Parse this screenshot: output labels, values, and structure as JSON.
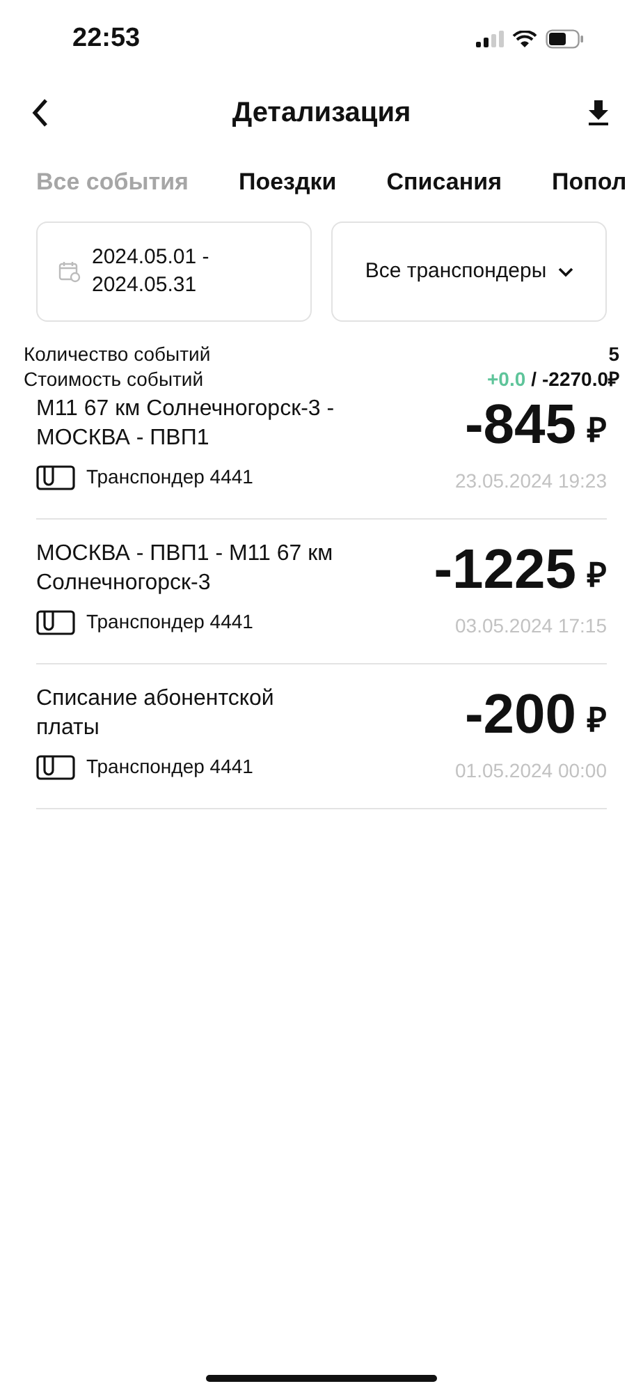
{
  "status_bar": {
    "time": "22:53"
  },
  "header": {
    "title": "Детализация"
  },
  "tabs": [
    {
      "label": "Все события",
      "selected": true
    },
    {
      "label": "Поездки",
      "selected": false
    },
    {
      "label": "Списания",
      "selected": false
    },
    {
      "label": "Попол",
      "selected": false
    }
  ],
  "filters": {
    "date_range": [
      "2024.05.01 -",
      "2024.05.31"
    ],
    "transponder": "Все транспондеры"
  },
  "summary": {
    "count_label": "Количество событий",
    "count": "5",
    "cost_label": "Стоимость событий",
    "income": "+0.0",
    "separator": "/",
    "expense": "-2270.0₽"
  },
  "events": [
    {
      "title": "М11 67 км Солнечногорск-3 - МОСКВА - ПВП1",
      "amount": "-845",
      "currency": "₽",
      "transponder": "Транспондер 4441",
      "datetime": "23.05.2024 19:23"
    },
    {
      "title": "МОСКВА - ПВП1 - М11 67 км Солнечногорск-3",
      "amount": "-1225",
      "currency": "₽",
      "transponder": "Транспондер 4441",
      "datetime": "03.05.2024 17:15"
    },
    {
      "title": "Списание абонентской платы",
      "amount": "-200",
      "currency": "₽",
      "transponder": "Транспондер 4441",
      "datetime": "01.05.2024 00:00"
    }
  ]
}
